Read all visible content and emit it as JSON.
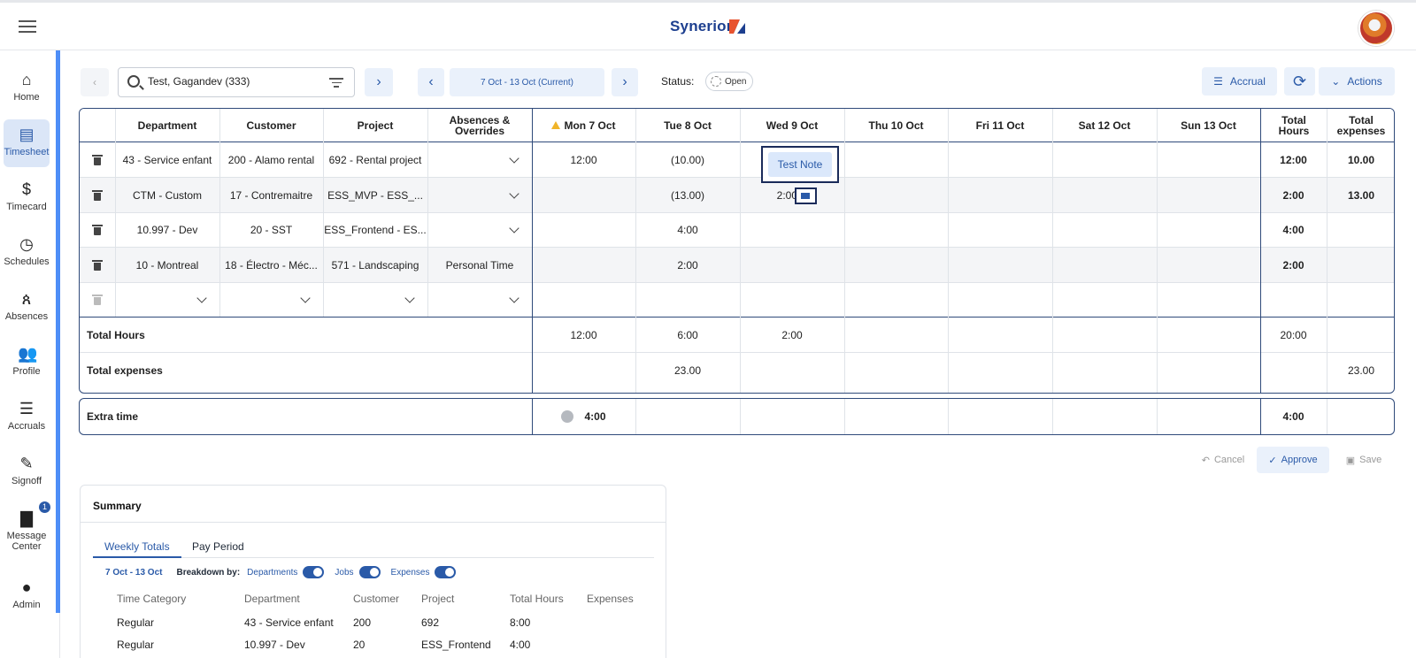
{
  "header": {
    "brand": "Synerion"
  },
  "sidebar": {
    "items": [
      {
        "label": "Home",
        "icon": "home-icon"
      },
      {
        "label": "Timesheet",
        "icon": "document-icon"
      },
      {
        "label": "Timecard",
        "icon": "dollar-icon"
      },
      {
        "label": "Schedules",
        "icon": "clock-icon"
      },
      {
        "label": "Absences",
        "icon": "person-x-icon"
      },
      {
        "label": "Profile",
        "icon": "people-icon"
      },
      {
        "label": "Accruals",
        "icon": "accrual-icon"
      },
      {
        "label": "Signoff",
        "icon": "signoff-icon"
      },
      {
        "label": "Message Center",
        "icon": "message-icon"
      },
      {
        "label": "Admin",
        "icon": "person-icon"
      }
    ],
    "message_badge": "1"
  },
  "toolbar": {
    "search_value": "Test, Gagandev (333)",
    "date_range": "7 Oct - 13 Oct (Current)",
    "status_label": "Status:",
    "status_value": "Open",
    "accrual": "Accrual",
    "actions": "Actions"
  },
  "grid": {
    "headers": {
      "department": "Department",
      "customer": "Customer",
      "project": "Project",
      "absences": "Absences & Overrides",
      "days": [
        "Mon 7 Oct",
        "Tue 8 Oct",
        "Wed 9 Oct",
        "Thu 10 Oct",
        "Fri 11 Oct",
        "Sat 12 Oct",
        "Sun 13 Oct"
      ],
      "total_hours": "Total Hours",
      "total_expenses": "Total expenses"
    },
    "rows": [
      {
        "department": "43 - Service enfant",
        "customer": "200 - Alamo rental",
        "project": "692 - Rental project",
        "absence": "",
        "days": [
          "12:00",
          "(10.00)",
          "",
          "",
          "",
          "",
          ""
        ],
        "total_hours": "12:00",
        "total_expenses": "10.00"
      },
      {
        "department": "CTM - Custom",
        "customer": "17 - Contremaitre",
        "project": "ESS_MVP - ESS_...",
        "absence": "",
        "days": [
          "",
          "(13.00)",
          "2:00",
          "",
          "",
          "",
          ""
        ],
        "total_hours": "2:00",
        "total_expenses": "13.00"
      },
      {
        "department": "10.997 - Dev",
        "customer": "20 - SST",
        "project": "ESS_Frontend - ES...",
        "absence": "",
        "days": [
          "",
          "4:00",
          "",
          "",
          "",
          "",
          ""
        ],
        "total_hours": "4:00",
        "total_expenses": ""
      },
      {
        "department": "10 - Montreal",
        "customer": "18 - Électro - Méc...",
        "project": "571 - Landscaping",
        "absence": "Personal Time",
        "days": [
          "",
          "2:00",
          "",
          "",
          "",
          "",
          ""
        ],
        "total_hours": "2:00",
        "total_expenses": ""
      }
    ],
    "total_hours": {
      "label": "Total Hours",
      "days": [
        "12:00",
        "6:00",
        "2:00",
        "",
        "",
        "",
        ""
      ],
      "total": "20:00",
      "expenses": ""
    },
    "total_expenses": {
      "label": "Total expenses",
      "days": [
        "",
        "23.00",
        "",
        "",
        "",
        "",
        ""
      ],
      "total": "",
      "expenses": "23.00"
    },
    "note_button": "Test Note"
  },
  "extra_time": {
    "label": "Extra time",
    "mon": "4:00",
    "total": "4:00"
  },
  "actions": {
    "cancel": "Cancel",
    "approve": "Approve",
    "save": "Save"
  },
  "summary": {
    "title": "Summary",
    "tabs": [
      "Weekly Totals",
      "Pay Period"
    ],
    "range": "7 Oct - 13 Oct",
    "breakdown_label": "Breakdown by:",
    "toggles": [
      "Departments",
      "Jobs",
      "Expenses"
    ],
    "columns": [
      "Time Category",
      "Department",
      "Customer",
      "Project",
      "Total Hours",
      "Expenses"
    ],
    "rows": [
      [
        "Regular",
        "43 - Service enfant",
        "200",
        "692",
        "8:00",
        ""
      ],
      [
        "Regular",
        "10.997 - Dev",
        "20",
        "ESS_Frontend",
        "4:00",
        ""
      ]
    ]
  },
  "colors": {
    "accent": "#2a5aa8",
    "grid_border": "#2f4a7a",
    "warning": "#f0b429"
  }
}
